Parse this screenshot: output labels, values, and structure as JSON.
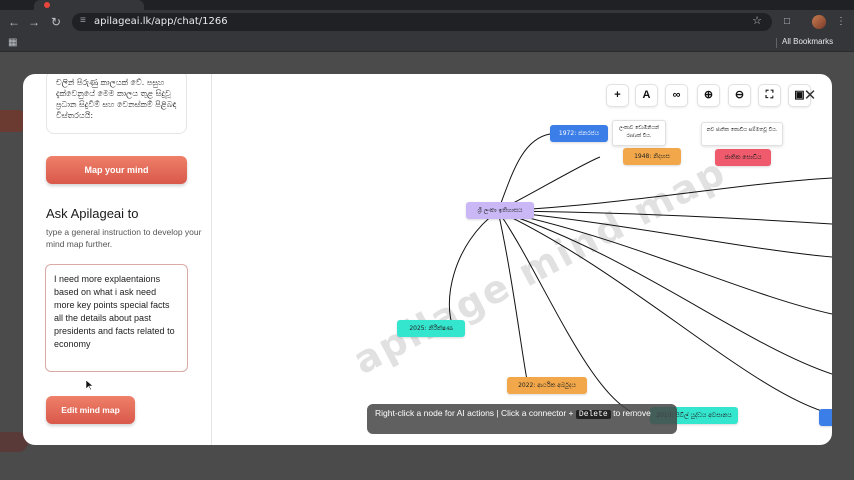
{
  "browser": {
    "url": "apilageai.lk/app/chat/1266",
    "bookmarks_label": "All Bookmarks"
  },
  "sidebar": {
    "summary_text": "චලින් පිරුණු කාලයක් වේ. පසුහ දැක්වෙනුයේ මෙම කාලය තුළ සිදුවූ ප්‍රධාන සිදුවීම් සහ වෙනස්කම් පිළිබඳ විස්තරයයි:",
    "map_button": "Map your mind",
    "ask_title": "Ask Apilageai to",
    "ask_subtitle": "type a general instruction to develop your mind map further.",
    "instruction_value": "I need more explaentaions based on what i ask need more key points special facts all the details about past presidents and facts related to economy",
    "edit_button": "Edit mind map"
  },
  "map": {
    "watermark": "apilage mind map",
    "toolbar_icons": [
      "plus-icon",
      "text-icon",
      "link-icon",
      "zoom-in-icon",
      "zoom-out-icon",
      "fullscreen-icon",
      "image-icon"
    ],
    "nodes": {
      "root": "ශ්‍රී ලංකා ඉතිහාසය",
      "n1972": "1972: ජනරජය",
      "n1948": "1948: නිදහස",
      "red": "ජාතික සොඩිය",
      "n2025": "2025: නිරීක්ෂණ",
      "n2022": "2022: ආර්ථික අර්බුදය",
      "n2010": "2010: සිවිල් යුද්ධය අවසානය"
    },
    "notes": {
      "note1": "ලංකාව ඩොමීනියන් රාජ්‍යක් විය.",
      "note2": "නව ජාතික කොඩිය සම්මතවූ විය."
    },
    "hint_before": "Right-click a node for AI actions | Click a connector +",
    "hint_key": "Delete",
    "hint_after": "to remove"
  }
}
